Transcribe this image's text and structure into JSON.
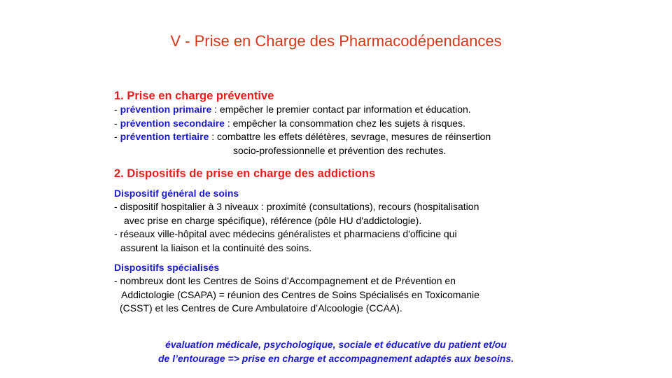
{
  "title": "V - Prise en Charge des Pharmacodépendances",
  "section1": {
    "heading": "1. Prise en charge préventive",
    "items": [
      {
        "prefix": "- ",
        "keyword": "prévention primaire",
        "text": " : empêcher le premier contact par information et éducation."
      },
      {
        "prefix": "- ",
        "keyword": "prévention secondaire",
        "text": " : empêcher la consommation chez les sujets à risques."
      },
      {
        "prefix": "- ",
        "keyword": "prévention tertiaire",
        "text": " : combattre les effets délétères, sevrage, mesures de réinsertion",
        "continuation": "socio-professionnelle et prévention des rechutes."
      }
    ]
  },
  "section2": {
    "heading": "2. Dispositifs de prise en charge des addictions",
    "general": {
      "heading": "Dispositif général de soins",
      "lines": [
        "- dispositif hospitalier à 3 niveaux : proximité (consultations), recours (hospitalisation",
        "avec prise en charge spécifique), référence (pôle HU d'addictologie).",
        "- réseaux ville-hôpital avec médecins généralistes et pharmaciens d'officine qui",
        "assurent la liaison et la continuité des soins."
      ]
    },
    "specialized": {
      "heading": "Dispositifs spécialisés",
      "lines": [
        "- nombreux dont les Centres de Soins d’Accompagnement et de Prévention en",
        "Addictologie (CSAPA) = réunion des Centres de Soins Spécialisés en Toxicomanie",
        "(CSST) et les Centres de Cure Ambulatoire d’Alcoologie (CCAA)."
      ]
    }
  },
  "conclusion": [
    "évaluation médicale, psychologique, sociale et éducative du patient et/ou",
    "de l’entourage => prise en charge et accompagnement adaptés aux besoins."
  ],
  "colors": {
    "title": "#d6361a",
    "heading_red": "#e41e1e",
    "keyword_blue": "#1a1ac8"
  }
}
